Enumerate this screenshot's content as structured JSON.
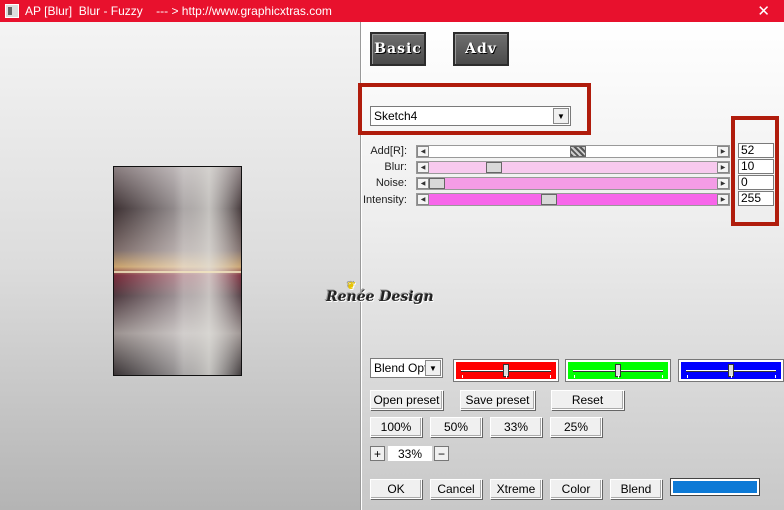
{
  "window": {
    "title": "AP [Blur]  Blur - Fuzzy    --- > http://www.graphicxtras.com",
    "close_glyph": "✕"
  },
  "watermark": {
    "text": "Renée Design"
  },
  "mode_buttons": {
    "basic": "Basic",
    "adv": "Adv"
  },
  "preset_select": {
    "value": "Sketch4"
  },
  "sliders": [
    {
      "label": "Add[R]:",
      "value": "52",
      "level": 0.52,
      "track_color": "#ffffff",
      "thumb": "hatched"
    },
    {
      "label": "Blur:",
      "value": "10",
      "level": 0.21,
      "track_color": "#f7c9ee"
    },
    {
      "label": "Noise:",
      "value": "0",
      "level": 0.0,
      "track_color": "#f49ce6"
    },
    {
      "label": "Intensity:",
      "value": "255",
      "level": 0.41,
      "track_color": "#f766ea"
    }
  ],
  "blend_select": {
    "value": "Blend Opti"
  },
  "color_sliders": [
    {
      "name": "red",
      "color": "#ff0000",
      "level": 0.5
    },
    {
      "name": "green",
      "color": "#00ff00",
      "level": 0.5
    },
    {
      "name": "blue",
      "color": "#0000ff",
      "level": 0.5
    }
  ],
  "preset_buttons": {
    "open": "Open preset",
    "save": "Save preset",
    "reset": "Reset"
  },
  "zoom_buttons": [
    "100%",
    "50%",
    "33%",
    "25%"
  ],
  "zoom_stepper": {
    "plus": "+",
    "value": "33%",
    "minus": "−"
  },
  "bottom_buttons": {
    "ok": "OK",
    "cancel": "Cancel",
    "xtreme": "Xtreme",
    "color": "Color",
    "blend": "Blend"
  },
  "blend_color": "#0d7ad6"
}
